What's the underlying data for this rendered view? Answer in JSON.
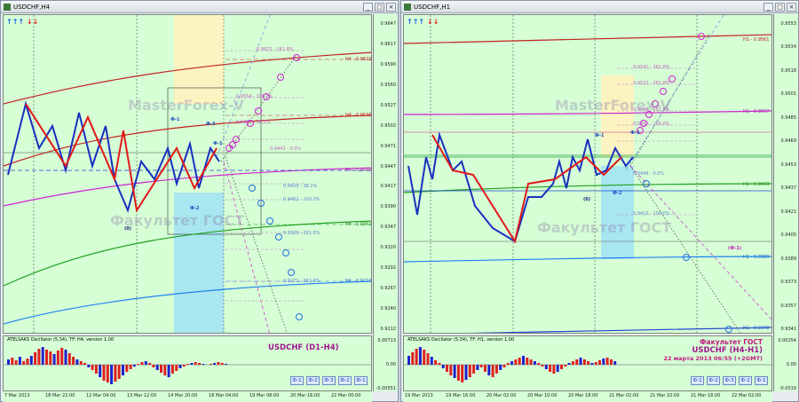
{
  "left": {
    "title": "USDCHF,H4",
    "price_labels": [
      "0.9647",
      "0.9617",
      "0.9590",
      "0.9560",
      "0.9527",
      "0.9502",
      "0.9471",
      "0.9447",
      "0.9417",
      "0.9390",
      "0.9347",
      "0.9320",
      "0.9292",
      "0.9267",
      "0.9240",
      "0.9212"
    ],
    "time_labels": [
      "7 Mar 2013",
      "18 Mar 22:00",
      "12 Mar 04:00",
      "13 Mar 12:00",
      "14 Mar 20:00",
      "18 Mar 04:00",
      "19 Mar 08:00",
      "20 Mar 16:00",
      "22 Mar 00:00"
    ],
    "osc_label": "ATELSAKS Oscillator (5,34), TF: H4, version 1.00",
    "osc_axis": [
      "0.00713",
      "0.00",
      "-0.00551"
    ],
    "pair_label": "USDCHF (D1-H4)",
    "watermark1": "MasterForex-V",
    "watermark2": "Факультет ГОСТ",
    "levels": [
      {
        "text": "H4 - 0.9622",
        "color": "#c02020"
      },
      {
        "text": "H4 - 0.9536",
        "color": "#c02020"
      },
      {
        "text": "H4 - 0.9448",
        "color": "#b020b0"
      },
      {
        "text": "H4 - 0.9361",
        "color": "#208020"
      },
      {
        "text": "H4 - 0.9274",
        "color": "#2060d0"
      }
    ],
    "fib_labels": [
      "0.9622 - 161.8%",
      "0.9554 - 100.0%",
      "0.9486 - 38.2%",
      "0.9442 - 0.0%",
      "0.9420 - 38.2%",
      "0.9401 - 100.0%",
      "0.9320 - 261.8%",
      "0.9272 - 361.8%"
    ],
    "marks": [
      "Ф-1",
      "Ф-3",
      "Ф-2",
      "(0)",
      "Ф-1"
    ],
    "current_price": "0.9471",
    "buttons": [
      "Ф-1",
      "Ф-2",
      "Ф-3",
      "Ф-2",
      "Ф-1"
    ]
  },
  "right": {
    "title": "USDCHF,H1",
    "price_labels": [
      "0.9553",
      "0.9534",
      "0.9518",
      "0.9501",
      "0.9485",
      "0.9469",
      "0.9453",
      "0.9437",
      "0.9421",
      "0.9405",
      "0.9389",
      "0.9373",
      "0.9357",
      "0.9341"
    ],
    "time_labels": [
      "19 Mar 2013",
      "19 Mar 16:00",
      "20 Mar 02:00",
      "20 Mar 10:00",
      "20 Mar 18:00",
      "21 Mar 02:00",
      "21 Mar 10:00",
      "21 Mar 18:00",
      "22 Mar 02:00"
    ],
    "osc_label": "ATELSAKS Oscillator (5,34), TF: H1, version 1.00",
    "osc_axis": [
      "0.00254",
      "0.00",
      "-0.0019"
    ],
    "caption1": "Факультет ГОСТ",
    "caption2": "USDCHF (H4-H1)",
    "caption3": "22 марта 2013 06:55 (+2GMT)",
    "watermark1": "MasterForex-V",
    "watermark2": "Факультет ГОСТ",
    "levels": [
      {
        "text": "H1 - 0.9561",
        "color": "#c02020"
      },
      {
        "text": "H1 - 0.9507",
        "color": "#b020b0"
      },
      {
        "text": "H1 - 0.9433",
        "color": "#208020"
      },
      {
        "text": "H1 - 0.9389",
        "color": "#2060d0"
      },
      {
        "text": "H1 - 0.9340",
        "color": "#2060d0"
      }
    ],
    "fib_labels": [
      "0.9541 - 361.8%",
      "0.9522 - 261.8%",
      "0.9506 - 161.8%",
      "0.9490 - 100.0%",
      "0.9446 - 0.0%",
      "0.9410 - 100.0%"
    ],
    "marks": [
      "Ф-1",
      "Ф-3",
      "(0)",
      "Ф-2",
      "(Ф-1)"
    ],
    "current_price": "0.9471",
    "buttons": [
      "Ф-1",
      "Ф-2",
      "Ф-3",
      "Ф-2",
      "Ф-1"
    ]
  },
  "arrows": "↑↑↑ ↓↓"
}
